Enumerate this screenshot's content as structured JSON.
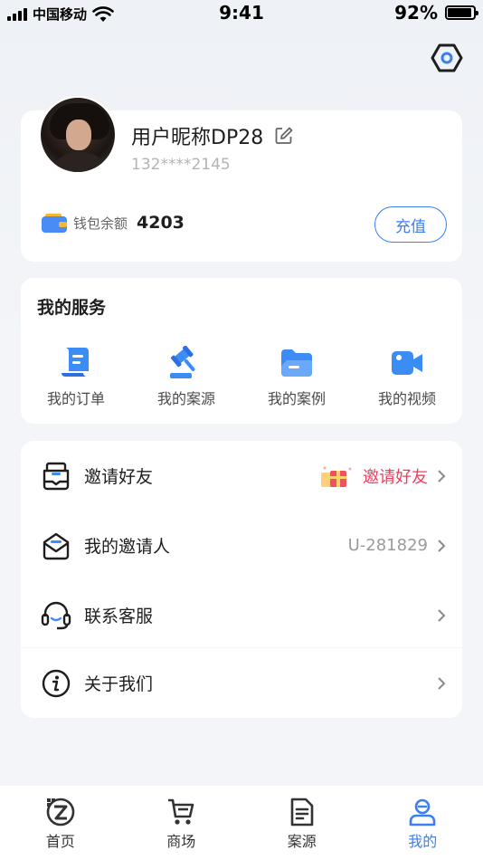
{
  "status_bar": {
    "carrier": "中国移动",
    "time": "9:41",
    "battery": "92%",
    "battery_level": 0.92
  },
  "profile": {
    "nickname": "用户昵称DP28",
    "phone": "132****2145",
    "wallet_label": "钱包余额",
    "wallet_amount": "4203",
    "recharge_label": "充值"
  },
  "services": {
    "title": "我的服务",
    "items": [
      {
        "label": "我的订单",
        "icon": "order-icon"
      },
      {
        "label": "我的案源",
        "icon": "gavel-icon"
      },
      {
        "label": "我的案例",
        "icon": "folder-icon"
      },
      {
        "label": "我的视频",
        "icon": "video-icon"
      }
    ]
  },
  "menu": {
    "items": [
      {
        "label": "邀请好友",
        "value": "邀请好友",
        "icon": "invite-icon"
      },
      {
        "label": "我的邀请人",
        "value": "U-281829",
        "icon": "mail-icon"
      },
      {
        "label": "联系客服",
        "value": "",
        "icon": "headset-icon"
      }
    ],
    "about": {
      "label": "关于我们",
      "icon": "info-icon"
    }
  },
  "tabs": [
    {
      "label": "首页",
      "icon": "home-logo-icon"
    },
    {
      "label": "商场",
      "icon": "cart-icon"
    },
    {
      "label": "案源",
      "icon": "document-icon"
    },
    {
      "label": "我的",
      "icon": "user-icon",
      "active": true
    }
  ],
  "colors": {
    "accent": "#3b7ff2",
    "invite_red": "#f23b5c"
  }
}
